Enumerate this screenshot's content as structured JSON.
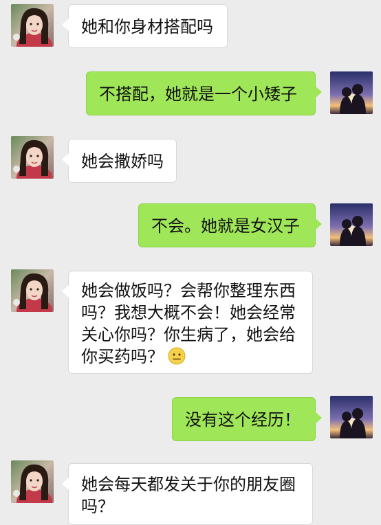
{
  "messages": [
    {
      "side": "in",
      "text": "她和你身材搭配吗"
    },
    {
      "side": "out",
      "text": "不搭配，她就是一个小矮子"
    },
    {
      "side": "in",
      "text": "她会撒娇吗"
    },
    {
      "side": "out",
      "text": "不会。她就是女汉子"
    },
    {
      "side": "in",
      "text": "她会做饭吗？会帮你整理东西吗？我想大概不会！她会经常关心你吗？你生病了，她会给你买药吗？",
      "emoji": "neutral-face-icon"
    },
    {
      "side": "out",
      "text": "没有这个经历！"
    },
    {
      "side": "in",
      "text": "她会每天都发关于你的朋友圈吗？"
    }
  ],
  "avatars": {
    "contact": "girl-portrait-avatar",
    "me": "couple-sunset-avatar"
  },
  "colors": {
    "background": "#ececec",
    "outgoing_bubble": "#9fe658",
    "incoming_bubble": "#ffffff"
  }
}
